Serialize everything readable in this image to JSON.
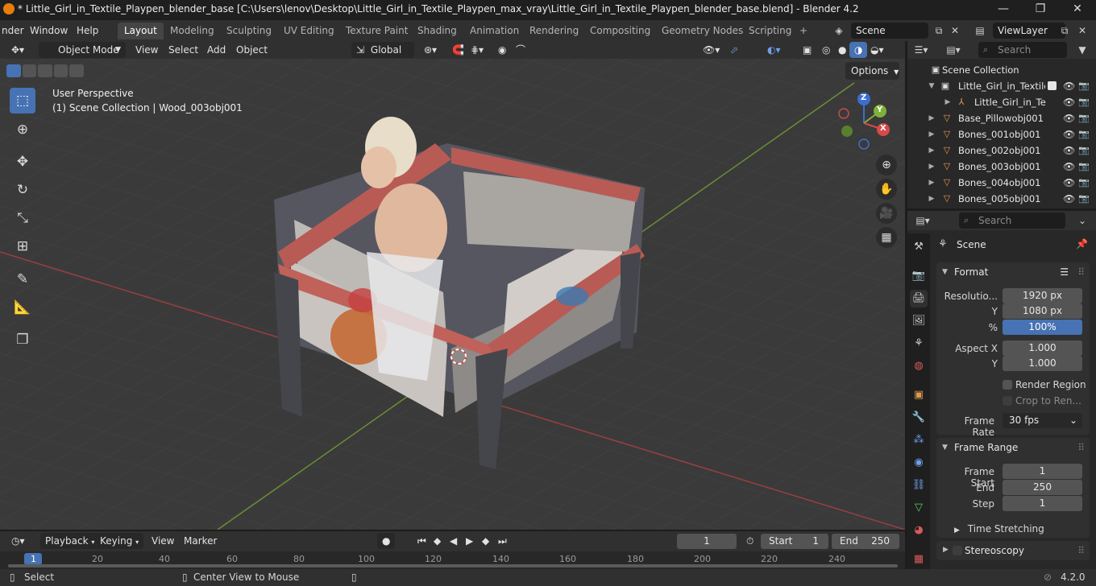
{
  "window": {
    "title": "* Little_Girl_in_Textile_Playpen_blender_base [C:\\Users\\lenov\\Desktop\\Little_Girl_in_Textile_Playpen_max_vray\\Little_Girl_in_Textile_Playpen_blender_base.blend] - Blender 4.2",
    "minimize": "—",
    "maximize": "❐",
    "close": "✕"
  },
  "menu": {
    "render": "nder",
    "window": "Window",
    "help": "Help"
  },
  "workspaces": [
    "Layout",
    "Modeling",
    "Sculpting",
    "UV Editing",
    "Texture Paint",
    "Shading",
    "Animation",
    "Rendering",
    "Compositing",
    "Geometry Nodes",
    "Scripting"
  ],
  "active_workspace": "Layout",
  "add_workspace": "+",
  "scene_field": "Scene",
  "viewlayer_field": "ViewLayer",
  "viewport_header": {
    "mode": "Object Mode",
    "view": "View",
    "select": "Select",
    "add": "Add",
    "object": "Object",
    "transform_orientation": "Global",
    "options": "Options"
  },
  "viewport": {
    "perspective_label": "User Perspective",
    "collection_label": "(1) Scene Collection | Wood_003obj001",
    "gizmo": {
      "z": "Z",
      "y": "Y",
      "x": "X"
    }
  },
  "outliner": {
    "search_placeholder": "Search",
    "rows": [
      {
        "name": "Scene Collection"
      },
      {
        "name": "Little_Girl_in_Textile_Playpen"
      },
      {
        "name": "Little_Girl_in_Te"
      },
      {
        "name": "Base_Pillowobj001"
      },
      {
        "name": "Bones_001obj001"
      },
      {
        "name": "Bones_002obj001"
      },
      {
        "name": "Bones_003obj001"
      },
      {
        "name": "Bones_004obj001"
      },
      {
        "name": "Bones_005obj001"
      }
    ]
  },
  "properties": {
    "search_placeholder": "Search",
    "context": "Scene",
    "format_panel": {
      "title": "Format",
      "resolution_x_label": "Resolutio...",
      "resolution_x": "1920 px",
      "resolution_y_label": "Y",
      "resolution_y": "1080 px",
      "percent_label": "%",
      "percent": "100%",
      "aspect_x_label": "Aspect X",
      "aspect_x": "1.000",
      "aspect_y_label": "Y",
      "aspect_y": "1.000",
      "render_region": "Render Region",
      "crop": "Crop to Ren...",
      "frame_rate_label": "Frame Rate",
      "frame_rate": "30 fps"
    },
    "frame_range_panel": {
      "title": "Frame Range",
      "start_label": "Frame Start",
      "start": "1",
      "end_label": "End",
      "end": "250",
      "step_label": "Step",
      "step": "1",
      "time_stretching": "Time Stretching"
    },
    "stereoscopy": "Stereoscopy"
  },
  "timeline": {
    "playback": "Playback",
    "keying": "Keying",
    "view": "View",
    "marker": "Marker",
    "current_frame": "1",
    "start_label": "Start",
    "start": "1",
    "end_label": "End",
    "end": "250",
    "ticks": [
      "1",
      "20",
      "40",
      "60",
      "80",
      "100",
      "120",
      "140",
      "160",
      "180",
      "200",
      "220",
      "240"
    ]
  },
  "statusbar": {
    "select": "Select",
    "center_view": "Center View to Mouse",
    "version": "4.2.0"
  }
}
